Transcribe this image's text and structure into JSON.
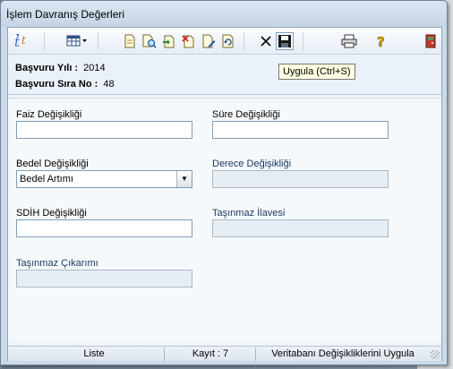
{
  "window": {
    "title": "İşlem Davranış Değerleri"
  },
  "toolbar": {
    "tooltip": "Uygula (Ctrl+S)",
    "icons": [
      "logo-icon",
      "grid-view-icon",
      "document-icon",
      "document-search-icon",
      "document-move-icon",
      "document-delete-icon",
      "document-edit-icon",
      "document-refresh-icon",
      "cancel-icon",
      "save-icon",
      "print-icon",
      "help-icon",
      "exit-icon"
    ]
  },
  "info": {
    "year_label": "Başvuru Yılı :",
    "year_value": "2014",
    "seq_label": "Başvuru Sıra No :",
    "seq_value": "48"
  },
  "form": {
    "faiz_label": "Faiz Değişikliği",
    "faiz_value": "",
    "sure_label": "Süre Değişikliği",
    "sure_value": "",
    "bedel_label": "Bedel Değişikliği",
    "bedel_value": "Bedel Artımı",
    "derece_label": "Derece Değişikliği",
    "derece_value": "",
    "sdih_label": "SDİH Değişikliği",
    "sdih_value": "",
    "tasinmaz_ilave_label": "Taşınmaz İlavesi",
    "tasinmaz_ilave_value": "",
    "tasinmaz_cikarimi_label": "Taşınmaz Çıkarımı",
    "tasinmaz_cikarimi_value": ""
  },
  "status": {
    "liste": "Liste",
    "kayit": "Kayıt : 7",
    "message": "Veritabanı Değişikliklerini Uygula"
  }
}
